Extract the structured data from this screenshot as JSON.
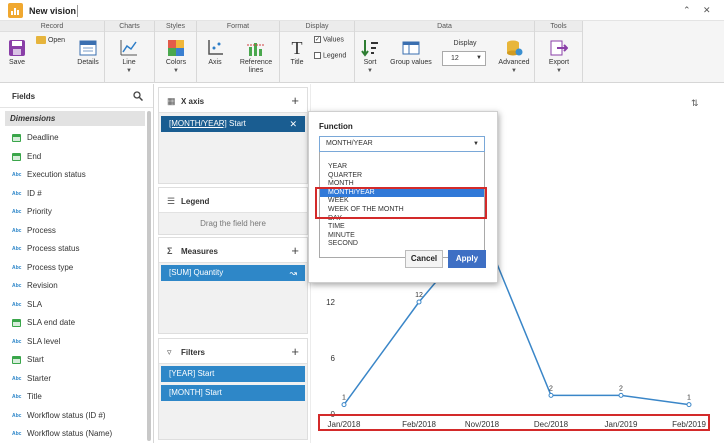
{
  "window": {
    "title": "New vision"
  },
  "ribbon": {
    "groups": {
      "record": "Record",
      "charts": "Charts",
      "styles": "Styles",
      "format": "Format",
      "display": "Display",
      "data": "Data",
      "tools": "Tools"
    },
    "save": "Save",
    "open": "Open",
    "details": "Details",
    "line": "Line",
    "colors": "Colors",
    "axis": "Axis",
    "reference_lines_1": "Reference",
    "reference_lines_2": "lines",
    "title": "Title",
    "values": "Values",
    "legend": "Legend",
    "sort": "Sort",
    "group_values": "Group values",
    "display_label": "Display",
    "display_value": "12",
    "advanced": "Advanced",
    "export": "Export"
  },
  "fields": {
    "title": "Fields",
    "dimensions_label": "Dimensions",
    "items": [
      {
        "label": "Deadline",
        "icon": "calendar-icon"
      },
      {
        "label": "End",
        "icon": "calendar-icon"
      },
      {
        "label": "Execution status",
        "icon": "text-field-icon"
      },
      {
        "label": "ID #",
        "icon": "text-field-icon"
      },
      {
        "label": "Priority",
        "icon": "text-field-icon"
      },
      {
        "label": "Process",
        "icon": "text-field-icon"
      },
      {
        "label": "Process status",
        "icon": "text-field-icon"
      },
      {
        "label": "Process type",
        "icon": "text-field-icon"
      },
      {
        "label": "Revision",
        "icon": "text-field-icon"
      },
      {
        "label": "SLA",
        "icon": "text-field-icon"
      },
      {
        "label": "SLA end date",
        "icon": "calendar-icon"
      },
      {
        "label": "SLA level",
        "icon": "text-field-icon"
      },
      {
        "label": "Start",
        "icon": "calendar-icon"
      },
      {
        "label": "Starter",
        "icon": "text-field-icon"
      },
      {
        "label": "Title",
        "icon": "text-field-icon"
      },
      {
        "label": "Workflow status (ID #)",
        "icon": "text-field-icon"
      },
      {
        "label": "Workflow status (Name)",
        "icon": "text-field-icon"
      }
    ],
    "text_icon_glyph": "Abc"
  },
  "xaxis": {
    "title": "X axis",
    "pill_prefix": "[MONTH/YEAR]",
    "pill_suffix": " Start"
  },
  "legend": {
    "title": "Legend",
    "placeholder": "Drag the field here"
  },
  "measures": {
    "title": "Measures",
    "pill": "[SUM] Quantity"
  },
  "filters": {
    "title": "Filters",
    "pills": [
      "[YEAR] Start",
      "[MONTH] Start"
    ]
  },
  "function_popup": {
    "label": "Function",
    "selected": "MONTH/YEAR",
    "options": [
      "YEAR",
      "QUARTER",
      "MONTH",
      "MONTH/YEAR",
      "WEEK",
      "WEEK OF THE MONTH",
      "DAY",
      "TIME",
      "MINUTE",
      "SECOND"
    ],
    "highlighted_index": 3,
    "cancel": "Cancel",
    "apply": "Apply"
  },
  "chart_data": {
    "type": "line",
    "categories": [
      "Jan/2018",
      "Feb/2018",
      "Nov/2018",
      "Dec/2018",
      "Jan/2019",
      "Feb/2019"
    ],
    "values": [
      1,
      12,
      20,
      2,
      2,
      1
    ],
    "data_labels": [
      "1",
      "12",
      "",
      "2",
      "2",
      "1"
    ],
    "y_ticks": [
      "0",
      "6",
      "12"
    ],
    "ylim": [
      0,
      24
    ],
    "series_color": "#3a86c8",
    "grid": false
  }
}
